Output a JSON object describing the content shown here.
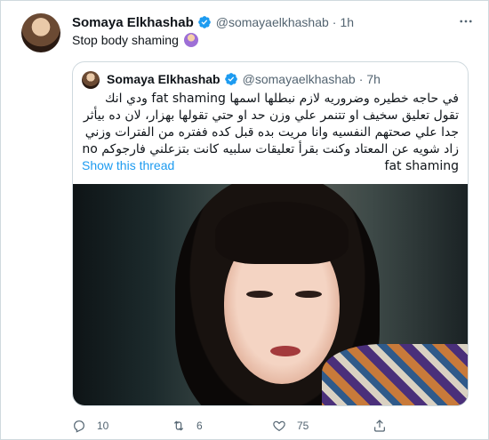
{
  "tweet": {
    "author_name": "Somaya Elkhashab",
    "handle": "@somayaelkhashab",
    "separator": "·",
    "time": "1h",
    "text": "Stop body shaming",
    "emoji_icon": "woman-gesturing-no-emoji",
    "more_icon": "more-icon"
  },
  "quoted_tweet": {
    "author_name": "Somaya Elkhashab",
    "handle": "@somayaelkhashab",
    "separator": "·",
    "time": "7h",
    "text": "في حاجه خطيره وضروريه لازم نبطلها اسمها fat shaming ودي انك تقول تعليق سخيف او تتنمر علي وزن حد او حتي تقولها بهزار، لان ده بيأثر جدا علي صحتهم النفسيه وانا مريت بده قبل كده ففتره من الفترات وزني زاد شويه عن المعتاد وكنت بقرأ تعليقات سلبيه كانت بتزعلني فارجوكم no fat shaming",
    "show_thread": "Show this thread"
  },
  "actions": {
    "reply_count": "10",
    "retweet_count": "6",
    "like_count": "75",
    "share_label": ""
  },
  "colors": {
    "accent": "#1d9bf0",
    "muted": "#536471",
    "border": "#cfd9de"
  }
}
